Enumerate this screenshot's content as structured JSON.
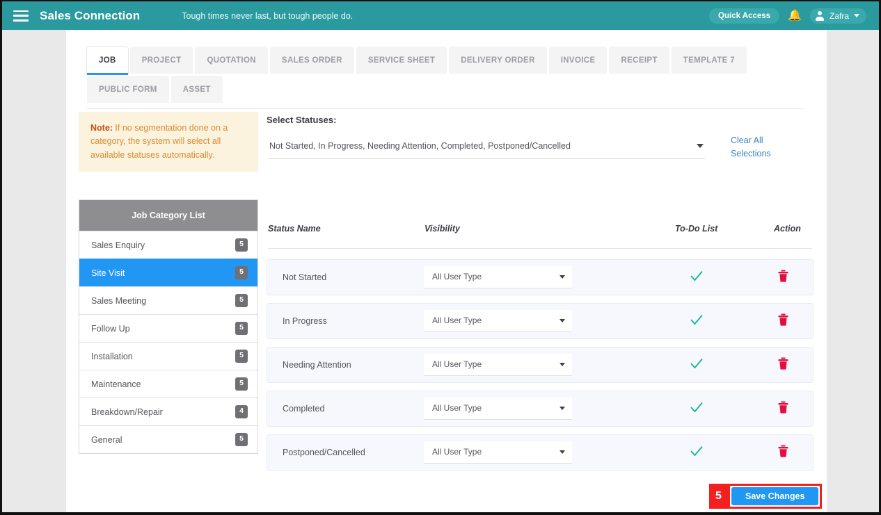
{
  "topbar": {
    "menu_icon": "hamburger-icon",
    "brand": "Sales Connection",
    "tagline": "Tough times never last, but tough people do.",
    "quick_access": "Quick Access",
    "bell_icon": "bell-icon",
    "user_name": "Zafra",
    "teal": "#2b9a9e"
  },
  "tabs": [
    {
      "label": "JOB",
      "active": true
    },
    {
      "label": "PROJECT",
      "active": false
    },
    {
      "label": "QUOTATION",
      "active": false
    },
    {
      "label": "SALES ORDER",
      "active": false
    },
    {
      "label": "SERVICE SHEET",
      "active": false
    },
    {
      "label": "DELIVERY ORDER",
      "active": false
    },
    {
      "label": "INVOICE",
      "active": false
    },
    {
      "label": "RECEIPT",
      "active": false
    },
    {
      "label": "TEMPLATE 7",
      "active": false
    },
    {
      "label": "PUBLIC FORM",
      "active": false
    },
    {
      "label": "ASSET",
      "active": false
    }
  ],
  "note": {
    "bold": "Note:",
    "text": " If no segmentation done on a category, the system will select all available statuses automatically."
  },
  "statuses": {
    "label": "Select Statuses:",
    "value": "Not Started, In Progress, Needing Attention, Completed, Postponed/Cancelled",
    "clear_all": "Clear All Selections"
  },
  "category_list": {
    "title": "Job Category List",
    "items": [
      {
        "label": "Sales Enquiry",
        "count": "5",
        "selected": false
      },
      {
        "label": "Site Visit",
        "count": "5",
        "selected": true
      },
      {
        "label": "Sales Meeting",
        "count": "5",
        "selected": false
      },
      {
        "label": "Follow Up",
        "count": "5",
        "selected": false
      },
      {
        "label": "Installation",
        "count": "5",
        "selected": false
      },
      {
        "label": "Maintenance",
        "count": "5",
        "selected": false
      },
      {
        "label": "Breakdown/Repair",
        "count": "4",
        "selected": false
      },
      {
        "label": "General",
        "count": "5",
        "selected": false
      }
    ],
    "selected_color": "#2196f3"
  },
  "table": {
    "headers": {
      "status_name": "Status Name",
      "visibility": "Visibility",
      "todo_list": "To-Do List",
      "action": "Action"
    },
    "rows": [
      {
        "status": "Not Started",
        "visibility": "All User Type",
        "todo": true,
        "delete_icon": "trash-icon"
      },
      {
        "status": "In Progress",
        "visibility": "All User Type",
        "todo": true,
        "delete_icon": "trash-icon"
      },
      {
        "status": "Needing Attention",
        "visibility": "All User Type",
        "todo": true,
        "delete_icon": "trash-icon"
      },
      {
        "status": "Completed",
        "visibility": "All User Type",
        "todo": true,
        "delete_icon": "trash-icon"
      },
      {
        "status": "Postponed/Cancelled",
        "visibility": "All User Type",
        "todo": true,
        "delete_icon": "trash-icon"
      }
    ],
    "check_color": "#1bb5a0",
    "trash_color": "#e2103f"
  },
  "footer": {
    "step_number": "5",
    "save_label": "Save Changes",
    "highlight_color": "#f42020",
    "button_color": "#2196f3"
  }
}
